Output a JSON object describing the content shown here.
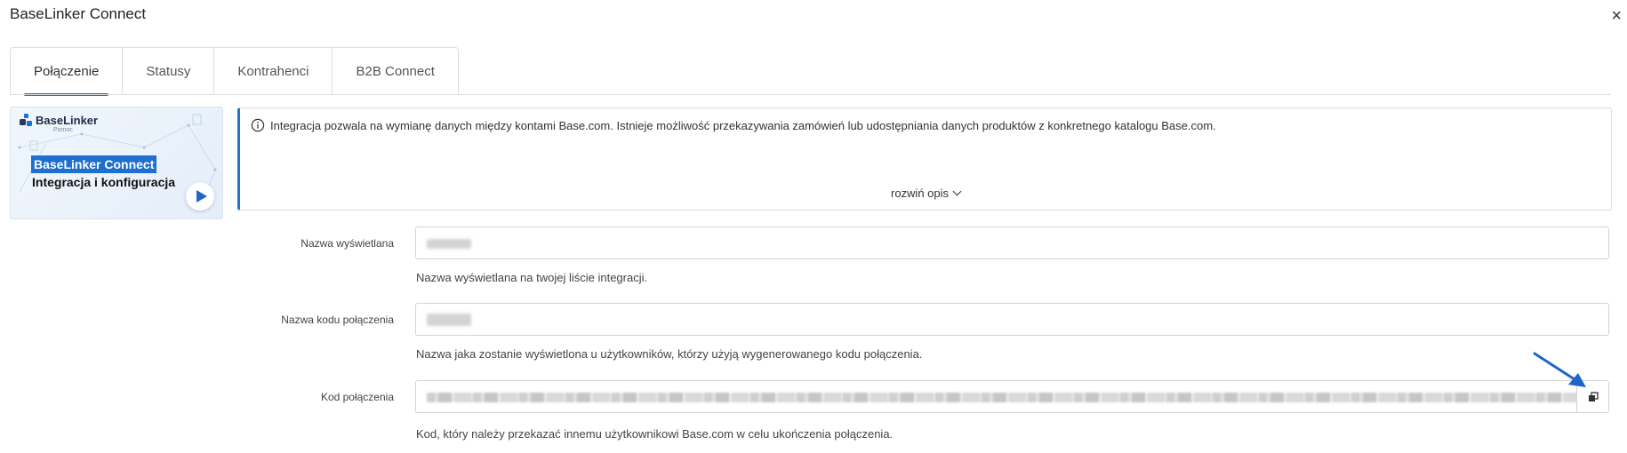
{
  "window": {
    "title": "BaseLinker Connect",
    "close_glyph": "×"
  },
  "tabs": [
    {
      "label": "Połączenie",
      "active": true
    },
    {
      "label": "Statusy",
      "active": false
    },
    {
      "label": "Kontrahenci",
      "active": false
    },
    {
      "label": "B2B Connect",
      "active": false
    }
  ],
  "video": {
    "brand": "BaseLinker",
    "brand_sub": "Pomoc",
    "title_line1": "BaseLinker Connect",
    "title_line2": "Integracja i konfiguracja",
    "play_icon": "play-icon"
  },
  "info": {
    "icon": "info-icon",
    "text": "Integracja pozwala na wymianę danych między kontami Base.com. Istnieje możliwość przekazywania zamówień lub udostępniania danych produktów z konkretnego katalogu Base.com.",
    "expand_label": "rozwiń opis"
  },
  "fields": {
    "display_name": {
      "label": "Nazwa wyświetlana",
      "help": "Nazwa wyświetlana na twojej liście integracji."
    },
    "code_name": {
      "label": "Nazwa kodu połączenia",
      "help": "Nazwa jaka zostanie wyświetlona u użytkowników, którzy użyją wygenerowanego kodu połączenia."
    },
    "connection_code": {
      "label": "Kod połączenia",
      "help": "Kod, który należy przekazać innemu użytkownikowi Base.com w celu ukończenia połączenia.",
      "copy_icon": "copy-icon"
    }
  },
  "colors": {
    "accent": "#1f73c9",
    "video_highlight": "#1f6fd1",
    "annotation_arrow": "#1f64c8"
  }
}
